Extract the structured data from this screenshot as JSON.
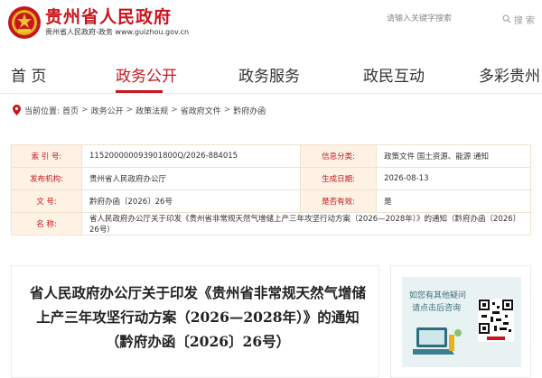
{
  "header": {
    "site_title": "贵州省人民政府",
    "site_sub": "贵州省人民政府-政务  www.guizhou.gov.cn"
  },
  "search": {
    "placeholder": "请输入关键字搜索",
    "button_label": "搜 索"
  },
  "nav": {
    "items": [
      {
        "label": "首 页"
      },
      {
        "label": "政务公开"
      },
      {
        "label": "政务服务"
      },
      {
        "label": "政民互动"
      },
      {
        "label": "多彩贵州"
      }
    ],
    "active_index": 1
  },
  "breadcrumb": {
    "prefix": "当前位置:",
    "items": [
      "首页",
      "政务公开",
      "政策法规",
      "省政府文件",
      "黔府办函"
    ],
    "separator": ">"
  },
  "info": {
    "index_label": "索 引 号:",
    "index_value": "115200000093901800Q/2026-884015",
    "category_label": "信息分类:",
    "category_value": "政策文件    国土资源、能源    通知",
    "issuer_label": "发布机构:",
    "issuer_value": "贵州省人民政府办公厅",
    "date_label": "生成日期:",
    "date_value": "2026-08-13",
    "docno_label": "文      号:",
    "docno_value": "黔府办函〔2026〕26号",
    "valid_label": "是否有效:",
    "valid_value": "是",
    "name_label": "名      称:",
    "name_value": "省人民政府办公厅关于印发《贵州省非常规天然气增储上产三年攻坚行动方案（2026—2028年）》的通知（黔府办函〔2026〕26号）"
  },
  "article": {
    "title": "省人民政府办公厅关于印发《贵州省非常规天然气增储上产三年攻坚行动方案（2026—2028年）》的通知（黔府办函〔2026〕26号）"
  },
  "side": {
    "promo_line1": "如您有其他疑问",
    "promo_line2": "请点击后咨询"
  },
  "colors": {
    "brand_red": "#c7161e",
    "label_bg": "#fdf2e4"
  }
}
